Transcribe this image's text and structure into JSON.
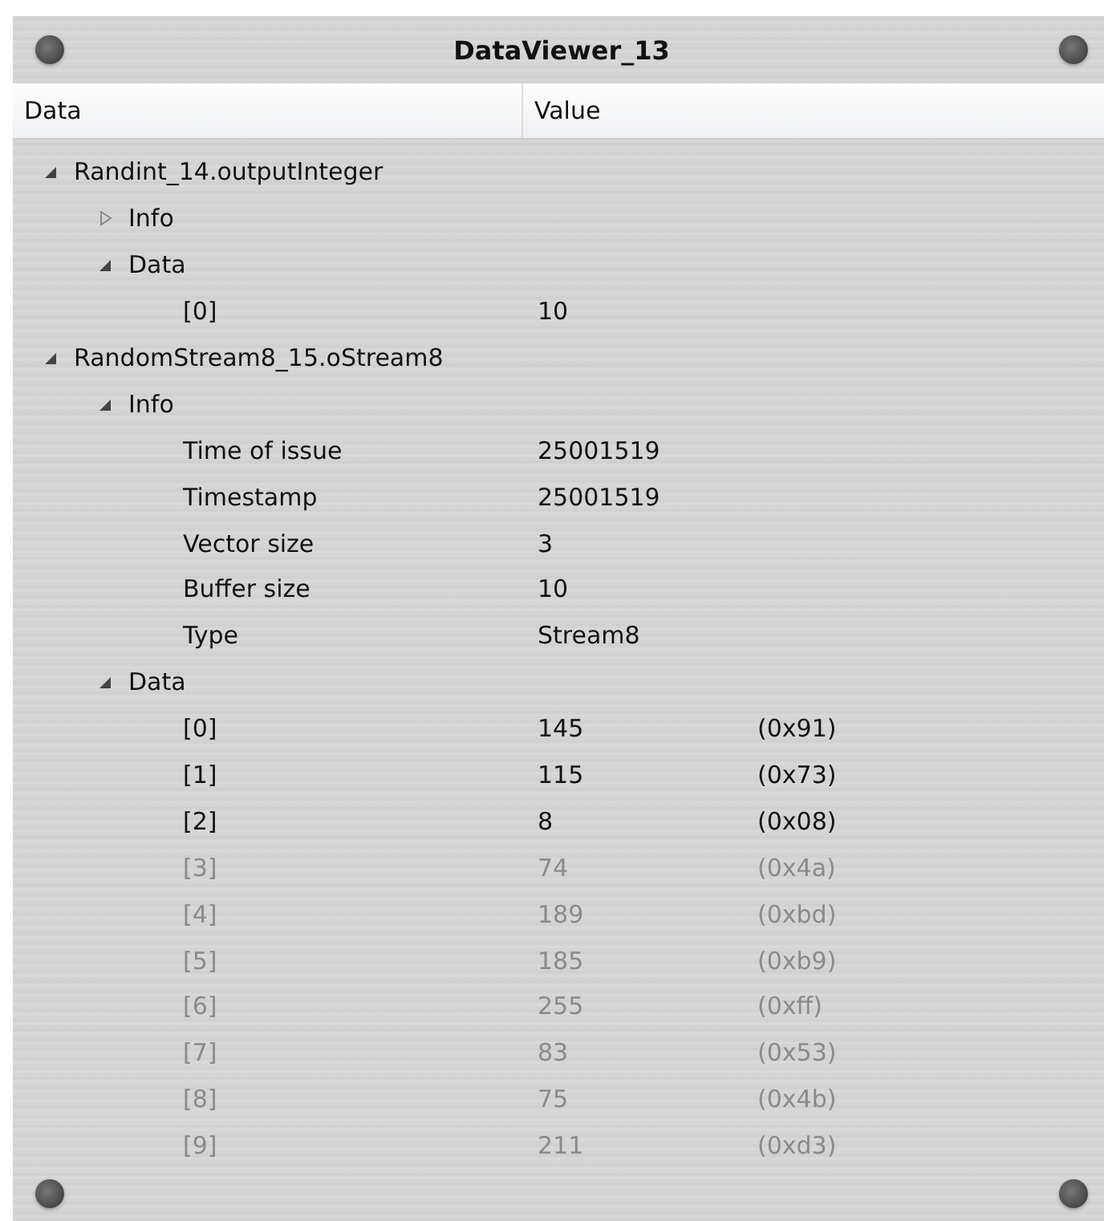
{
  "window": {
    "title": "DataViewer_13"
  },
  "columns": [
    "Data",
    "Value"
  ],
  "tree": [
    {
      "label": "Randint_14.outputInteger",
      "expanded": true,
      "children": [
        {
          "label": "Info",
          "expanded": false
        },
        {
          "label": "Data",
          "expanded": true,
          "children": [
            {
              "label": "[0]",
              "value": "10"
            }
          ]
        }
      ]
    },
    {
      "label": "RandomStream8_15.oStream8",
      "expanded": true,
      "children": [
        {
          "label": "Info",
          "expanded": true,
          "children": [
            {
              "label": "Time of issue",
              "value": "25001519"
            },
            {
              "label": "Timestamp",
              "value": "25001519"
            },
            {
              "label": "Vector size",
              "value": "3"
            },
            {
              "label": "Buffer size",
              "value": "10"
            },
            {
              "label": "Type",
              "value": "Stream8"
            }
          ]
        },
        {
          "label": "Data",
          "expanded": true,
          "children": [
            {
              "label": "[0]",
              "value": "145",
              "hex": "(0x91)",
              "disabled": false
            },
            {
              "label": "[1]",
              "value": "115",
              "hex": "(0x73)",
              "disabled": false
            },
            {
              "label": "[2]",
              "value": "8",
              "hex": "(0x08)",
              "disabled": false
            },
            {
              "label": "[3]",
              "value": "74",
              "hex": "(0x4a)",
              "disabled": true
            },
            {
              "label": "[4]",
              "value": "189",
              "hex": "(0xbd)",
              "disabled": true
            },
            {
              "label": "[5]",
              "value": "185",
              "hex": "(0xb9)",
              "disabled": true
            },
            {
              "label": "[6]",
              "value": "255",
              "hex": "(0xff)",
              "disabled": true
            },
            {
              "label": "[7]",
              "value": "83",
              "hex": "(0x53)",
              "disabled": true
            },
            {
              "label": "[8]",
              "value": "75",
              "hex": "(0x4b)",
              "disabled": true
            },
            {
              "label": "[9]",
              "value": "211",
              "hex": "(0xd3)",
              "disabled": true
            }
          ]
        }
      ]
    }
  ]
}
